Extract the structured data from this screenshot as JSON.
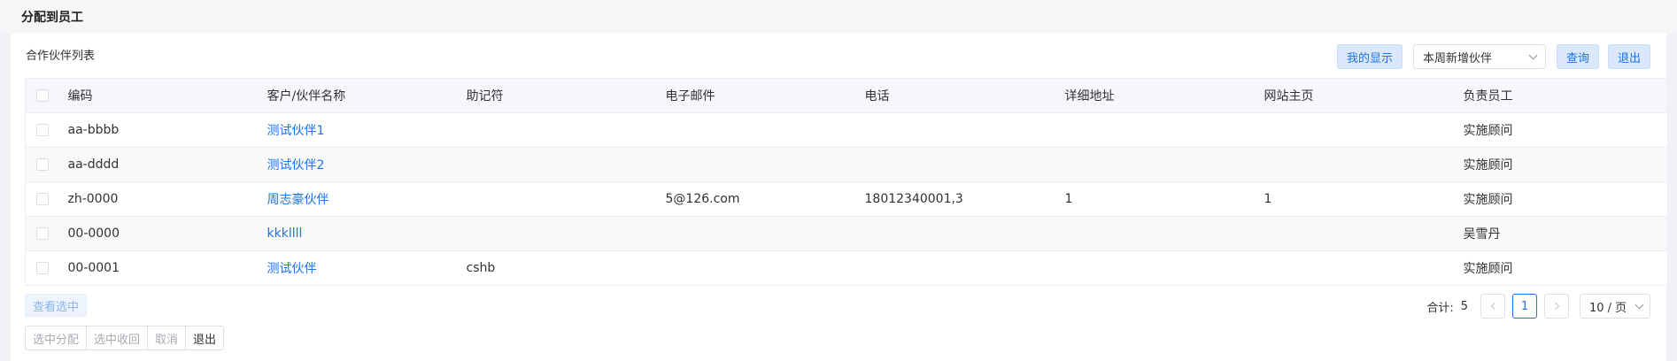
{
  "page": {
    "title": "分配到员工"
  },
  "panel": {
    "title": "合作伙伴列表"
  },
  "toolbar": {
    "my_display": "我的显示",
    "filter_value": "本周新增伙伴",
    "query": "查询",
    "exit": "退出"
  },
  "table": {
    "headers": [
      "编码",
      "客户/伙伴名称",
      "助记符",
      "电子邮件",
      "电话",
      "详细地址",
      "网站主页",
      "负责员工"
    ],
    "rows": [
      {
        "code": "aa-bbbb",
        "name": "测试伙伴1",
        "mnemonic": "",
        "email": "",
        "phone": "",
        "address": "",
        "website": "",
        "staff": "实施顾问"
      },
      {
        "code": "aa-dddd",
        "name": "测试伙伴2",
        "mnemonic": "",
        "email": "",
        "phone": "",
        "address": "",
        "website": "",
        "staff": "实施顾问"
      },
      {
        "code": "zh-0000",
        "name": "周志豪伙伴",
        "mnemonic": "",
        "email": "5@126.com",
        "phone": "18012340001,3",
        "address": "1",
        "website": "1",
        "staff": "实施顾问"
      },
      {
        "code": "00-0000",
        "name": "kkkllll",
        "mnemonic": "",
        "email": "",
        "phone": "",
        "address": "",
        "website": "",
        "staff": "吴雪丹"
      },
      {
        "code": "00-0001",
        "name": "测试伙伴",
        "mnemonic": "cshb",
        "email": "",
        "phone": "",
        "address": "",
        "website": "",
        "staff": "实施顾问"
      }
    ]
  },
  "footer": {
    "view_selected": "查看选中",
    "buttons": [
      "选中分配",
      "选中收回",
      "取消",
      "退出"
    ]
  },
  "pagination": {
    "total_label": "合计:",
    "total_value": "5",
    "current_page": "1",
    "page_size": "10 / 页"
  },
  "colors": {
    "accent": "#1a73e8",
    "header_bg": "#f5f7fa"
  },
  "icons": {
    "dropdown": "chevron-down-icon",
    "prev": "chevron-left-icon",
    "next": "chevron-right-icon"
  }
}
